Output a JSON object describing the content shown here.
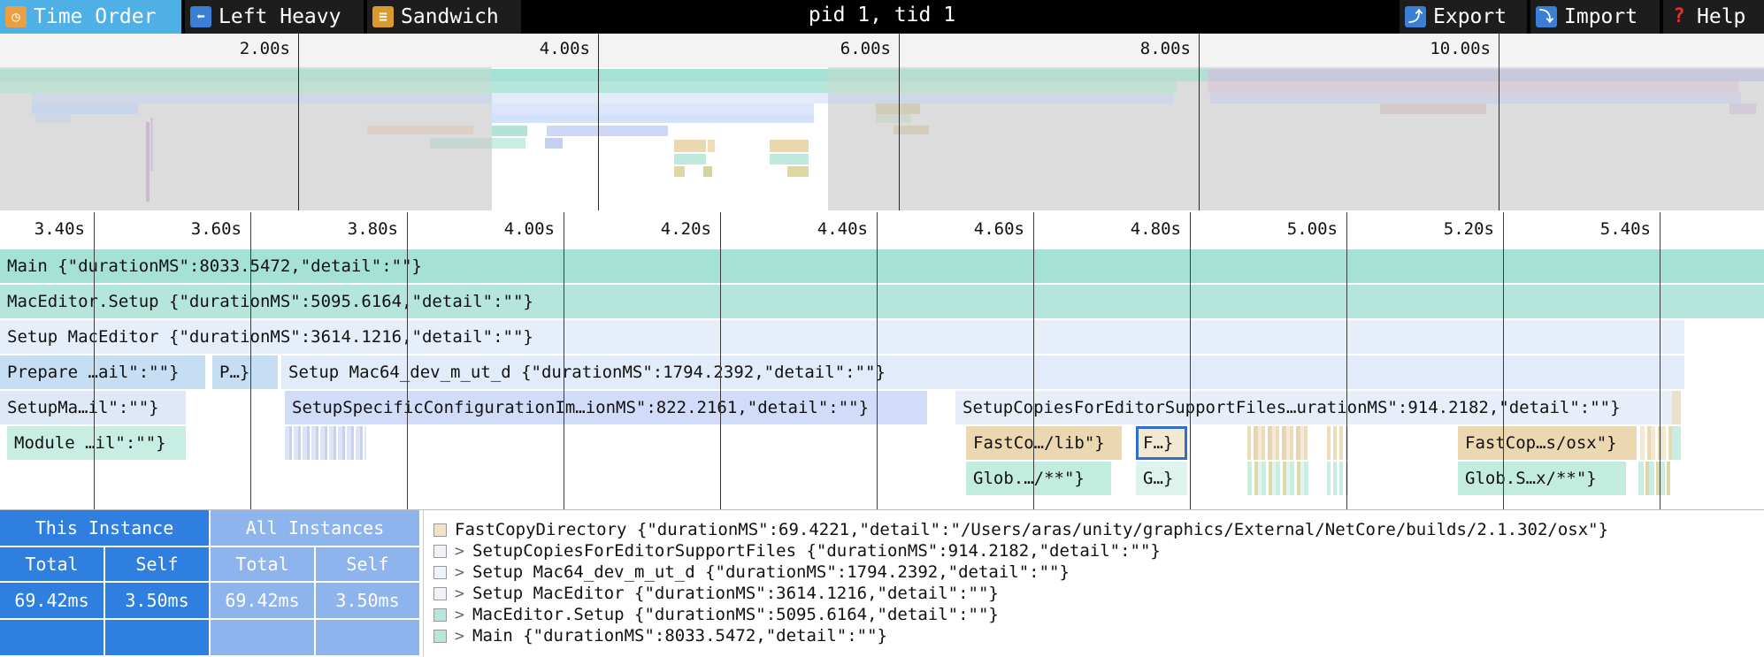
{
  "toolbar": {
    "tabs": [
      {
        "label": "Time Order",
        "icon": "stopwatch-icon"
      },
      {
        "label": "Left Heavy",
        "icon": "left-arrow-icon"
      },
      {
        "label": "Sandwich",
        "icon": "sandwich-icon"
      }
    ],
    "title": "pid 1, tid 1",
    "export_label": "Export",
    "import_label": "Import",
    "help_label": "Help",
    "accent_color": "#4fb0e6"
  },
  "overview": {
    "ticks": [
      "2.00s",
      "4.00s",
      "6.00s",
      "8.00s",
      "10.00s"
    ]
  },
  "flamegraph": {
    "ticks": [
      "3.40s",
      "3.60s",
      "3.80s",
      "4.00s",
      "4.20s",
      "4.40s",
      "4.60s",
      "4.80s",
      "5.00s",
      "5.20s",
      "5.40s"
    ],
    "frames": [
      "Main {\"durationMS\":8033.5472,\"detail\":\"\"}",
      "MacEditor.Setup {\"durationMS\":5095.6164,\"detail\":\"\"}",
      "Setup MacEditor {\"durationMS\":3614.1216,\"detail\":\"\"}",
      "Prepare …ail\":\"\"}",
      "P…}",
      "Setup Mac64_dev_m_ut_d {\"durationMS\":1794.2392,\"detail\":\"\"}",
      "SetupMa…il\":\"\"}",
      "SetupSpecificConfigurationIm…ionMS\":822.2161,\"detail\":\"\"}",
      "SetupCopiesForEditorSupportFiles…urationMS\":914.2182,\"detail\":\"\"}",
      "Module …il\":\"\"}",
      "FastCo…/lib\"}",
      "F…}",
      "FastCop…s/osx\"}",
      "Glob.…/**\"}",
      "G…}",
      "Glob.S…x/**\"}"
    ]
  },
  "details": {
    "this_instance": "This Instance",
    "all_instances": "All Instances",
    "total_label": "Total",
    "self_label": "Self",
    "this_total": "69.42ms",
    "this_self": "3.50ms",
    "all_total": "69.42ms",
    "all_self": "3.50ms",
    "stack": [
      {
        "text": "FastCopyDirectory {\"durationMS\":69.4221,\"detail\":\"/Users/aras/unity/graphics/External/NetCore/builds/2.1.302/osx\"}",
        "color": "#f1e3c8",
        "arrow": ""
      },
      {
        "text": "SetupCopiesForEditorSupportFiles {\"durationMS\":914.2182,\"detail\":\"\"}",
        "color": "#eef2fa",
        "arrow": ">"
      },
      {
        "text": "Setup Mac64_dev_m_ut_d {\"durationMS\":1794.2392,\"detail\":\"\"}",
        "color": "#eef2fa",
        "arrow": ">"
      },
      {
        "text": "Setup MacEditor {\"durationMS\":3614.1216,\"detail\":\"\"}",
        "color": "#eef2fa",
        "arrow": ">"
      },
      {
        "text": "MacEditor.Setup {\"durationMS\":5095.6164,\"detail\":\"\"}",
        "color": "#b6e7de",
        "arrow": ">"
      },
      {
        "text": "Main {\"durationMS\":8033.5472,\"detail\":\"\"}",
        "color": "#b6e7de",
        "arrow": ">"
      }
    ]
  }
}
